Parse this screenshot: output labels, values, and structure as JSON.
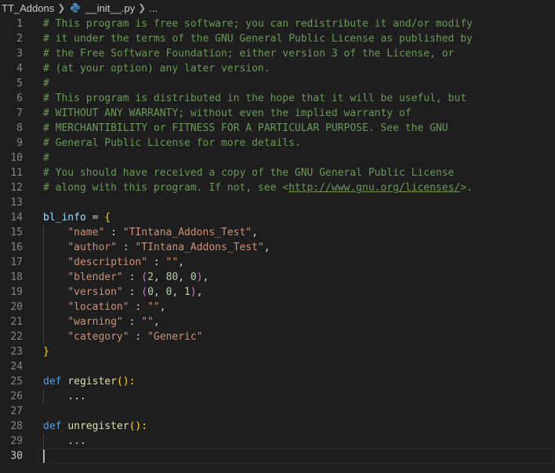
{
  "breadcrumb": {
    "folder": "TT_Addons",
    "file": "__init__.py",
    "symbol": "..."
  },
  "editor": {
    "language": "python",
    "active_line": 30,
    "lines": [
      {
        "n": "1",
        "tokens": [
          {
            "t": "# This program is free software; you can redistribute it and/or modify",
            "c": "comment"
          }
        ]
      },
      {
        "n": "2",
        "tokens": [
          {
            "t": "# it under the terms of the GNU General Public License as published by",
            "c": "comment"
          }
        ]
      },
      {
        "n": "3",
        "tokens": [
          {
            "t": "# the Free Software Foundation; either version 3 of the License, or",
            "c": "comment"
          }
        ]
      },
      {
        "n": "4",
        "tokens": [
          {
            "t": "# (at your option) any later version.",
            "c": "comment"
          }
        ]
      },
      {
        "n": "5",
        "tokens": [
          {
            "t": "#",
            "c": "comment"
          }
        ]
      },
      {
        "n": "6",
        "tokens": [
          {
            "t": "# This program is distributed in the hope that it will be useful, but",
            "c": "comment"
          }
        ]
      },
      {
        "n": "7",
        "tokens": [
          {
            "t": "# WITHOUT ANY WARRANTY; without even the implied warranty of",
            "c": "comment"
          }
        ]
      },
      {
        "n": "8",
        "tokens": [
          {
            "t": "# MERCHANTIBILITY or FITNESS FOR A PARTICULAR PURPOSE. See the GNU",
            "c": "comment"
          }
        ]
      },
      {
        "n": "9",
        "tokens": [
          {
            "t": "# General Public License for more details.",
            "c": "comment"
          }
        ]
      },
      {
        "n": "10",
        "tokens": [
          {
            "t": "#",
            "c": "comment"
          }
        ]
      },
      {
        "n": "11",
        "tokens": [
          {
            "t": "# You should have received a copy of the GNU General Public License",
            "c": "comment"
          }
        ]
      },
      {
        "n": "12",
        "tokens": [
          {
            "t": "# along with this program. If not, see <",
            "c": "comment"
          },
          {
            "t": "http://www.gnu.org/licenses/",
            "c": "link"
          },
          {
            "t": ">.",
            "c": "comment"
          }
        ]
      },
      {
        "n": "13",
        "tokens": []
      },
      {
        "n": "14",
        "tokens": [
          {
            "t": "bl_info",
            "c": "var"
          },
          {
            "t": " = ",
            "c": "plain"
          },
          {
            "t": "{",
            "c": "brace1"
          }
        ]
      },
      {
        "n": "15",
        "tokens": [
          {
            "t": "    ",
            "c": "plain"
          },
          {
            "t": "\"name\"",
            "c": "str"
          },
          {
            "t": " : ",
            "c": "plain"
          },
          {
            "t": "\"TIntana_Addons_Test\"",
            "c": "str"
          },
          {
            "t": ",",
            "c": "plain"
          }
        ]
      },
      {
        "n": "16",
        "tokens": [
          {
            "t": "    ",
            "c": "plain"
          },
          {
            "t": "\"author\"",
            "c": "str"
          },
          {
            "t": " : ",
            "c": "plain"
          },
          {
            "t": "\"TIntana_Addons_Test\"",
            "c": "str"
          },
          {
            "t": ",",
            "c": "plain"
          }
        ]
      },
      {
        "n": "17",
        "tokens": [
          {
            "t": "    ",
            "c": "plain"
          },
          {
            "t": "\"description\"",
            "c": "str"
          },
          {
            "t": " : ",
            "c": "plain"
          },
          {
            "t": "\"\"",
            "c": "str"
          },
          {
            "t": ",",
            "c": "plain"
          }
        ]
      },
      {
        "n": "18",
        "tokens": [
          {
            "t": "    ",
            "c": "plain"
          },
          {
            "t": "\"blender\"",
            "c": "str"
          },
          {
            "t": " : ",
            "c": "plain"
          },
          {
            "t": "(",
            "c": "brace2"
          },
          {
            "t": "2",
            "c": "num"
          },
          {
            "t": ", ",
            "c": "plain"
          },
          {
            "t": "80",
            "c": "num"
          },
          {
            "t": ", ",
            "c": "plain"
          },
          {
            "t": "0",
            "c": "num"
          },
          {
            "t": ")",
            "c": "brace2"
          },
          {
            "t": ",",
            "c": "plain"
          }
        ]
      },
      {
        "n": "19",
        "tokens": [
          {
            "t": "    ",
            "c": "plain"
          },
          {
            "t": "\"version\"",
            "c": "str"
          },
          {
            "t": " : ",
            "c": "plain"
          },
          {
            "t": "(",
            "c": "brace2"
          },
          {
            "t": "0",
            "c": "num"
          },
          {
            "t": ", ",
            "c": "plain"
          },
          {
            "t": "0",
            "c": "num"
          },
          {
            "t": ", ",
            "c": "plain"
          },
          {
            "t": "1",
            "c": "num"
          },
          {
            "t": ")",
            "c": "brace2"
          },
          {
            "t": ",",
            "c": "plain"
          }
        ]
      },
      {
        "n": "20",
        "tokens": [
          {
            "t": "    ",
            "c": "plain"
          },
          {
            "t": "\"location\"",
            "c": "str"
          },
          {
            "t": " : ",
            "c": "plain"
          },
          {
            "t": "\"\"",
            "c": "str"
          },
          {
            "t": ",",
            "c": "plain"
          }
        ]
      },
      {
        "n": "21",
        "tokens": [
          {
            "t": "    ",
            "c": "plain"
          },
          {
            "t": "\"warning\"",
            "c": "str"
          },
          {
            "t": " : ",
            "c": "plain"
          },
          {
            "t": "\"\"",
            "c": "str"
          },
          {
            "t": ",",
            "c": "plain"
          }
        ]
      },
      {
        "n": "22",
        "tokens": [
          {
            "t": "    ",
            "c": "plain"
          },
          {
            "t": "\"category\"",
            "c": "str"
          },
          {
            "t": " : ",
            "c": "plain"
          },
          {
            "t": "\"Generic\"",
            "c": "str"
          }
        ]
      },
      {
        "n": "23",
        "tokens": [
          {
            "t": "}",
            "c": "brace1"
          }
        ]
      },
      {
        "n": "24",
        "tokens": []
      },
      {
        "n": "25",
        "tokens": [
          {
            "t": "def",
            "c": "kw"
          },
          {
            "t": " ",
            "c": "plain"
          },
          {
            "t": "register",
            "c": "fn"
          },
          {
            "t": "():",
            "c": "brace1"
          }
        ]
      },
      {
        "n": "26",
        "tokens": [
          {
            "t": "    ",
            "c": "plain"
          },
          {
            "t": "...",
            "c": "plain"
          }
        ]
      },
      {
        "n": "27",
        "tokens": []
      },
      {
        "n": "28",
        "tokens": [
          {
            "t": "def",
            "c": "kw"
          },
          {
            "t": " ",
            "c": "plain"
          },
          {
            "t": "unregister",
            "c": "fn"
          },
          {
            "t": "():",
            "c": "brace1"
          }
        ]
      },
      {
        "n": "29",
        "tokens": [
          {
            "t": "    ",
            "c": "plain"
          },
          {
            "t": "...",
            "c": "plain"
          }
        ]
      },
      {
        "n": "30",
        "tokens": []
      }
    ]
  },
  "colors": {
    "background": "#1e1e1e",
    "comment": "#6a9955",
    "string": "#ce9178",
    "keyword": "#569cd6",
    "function": "#dcdcaa",
    "variable": "#9cdcfe",
    "number": "#b5cea8",
    "line_number": "#858585"
  }
}
